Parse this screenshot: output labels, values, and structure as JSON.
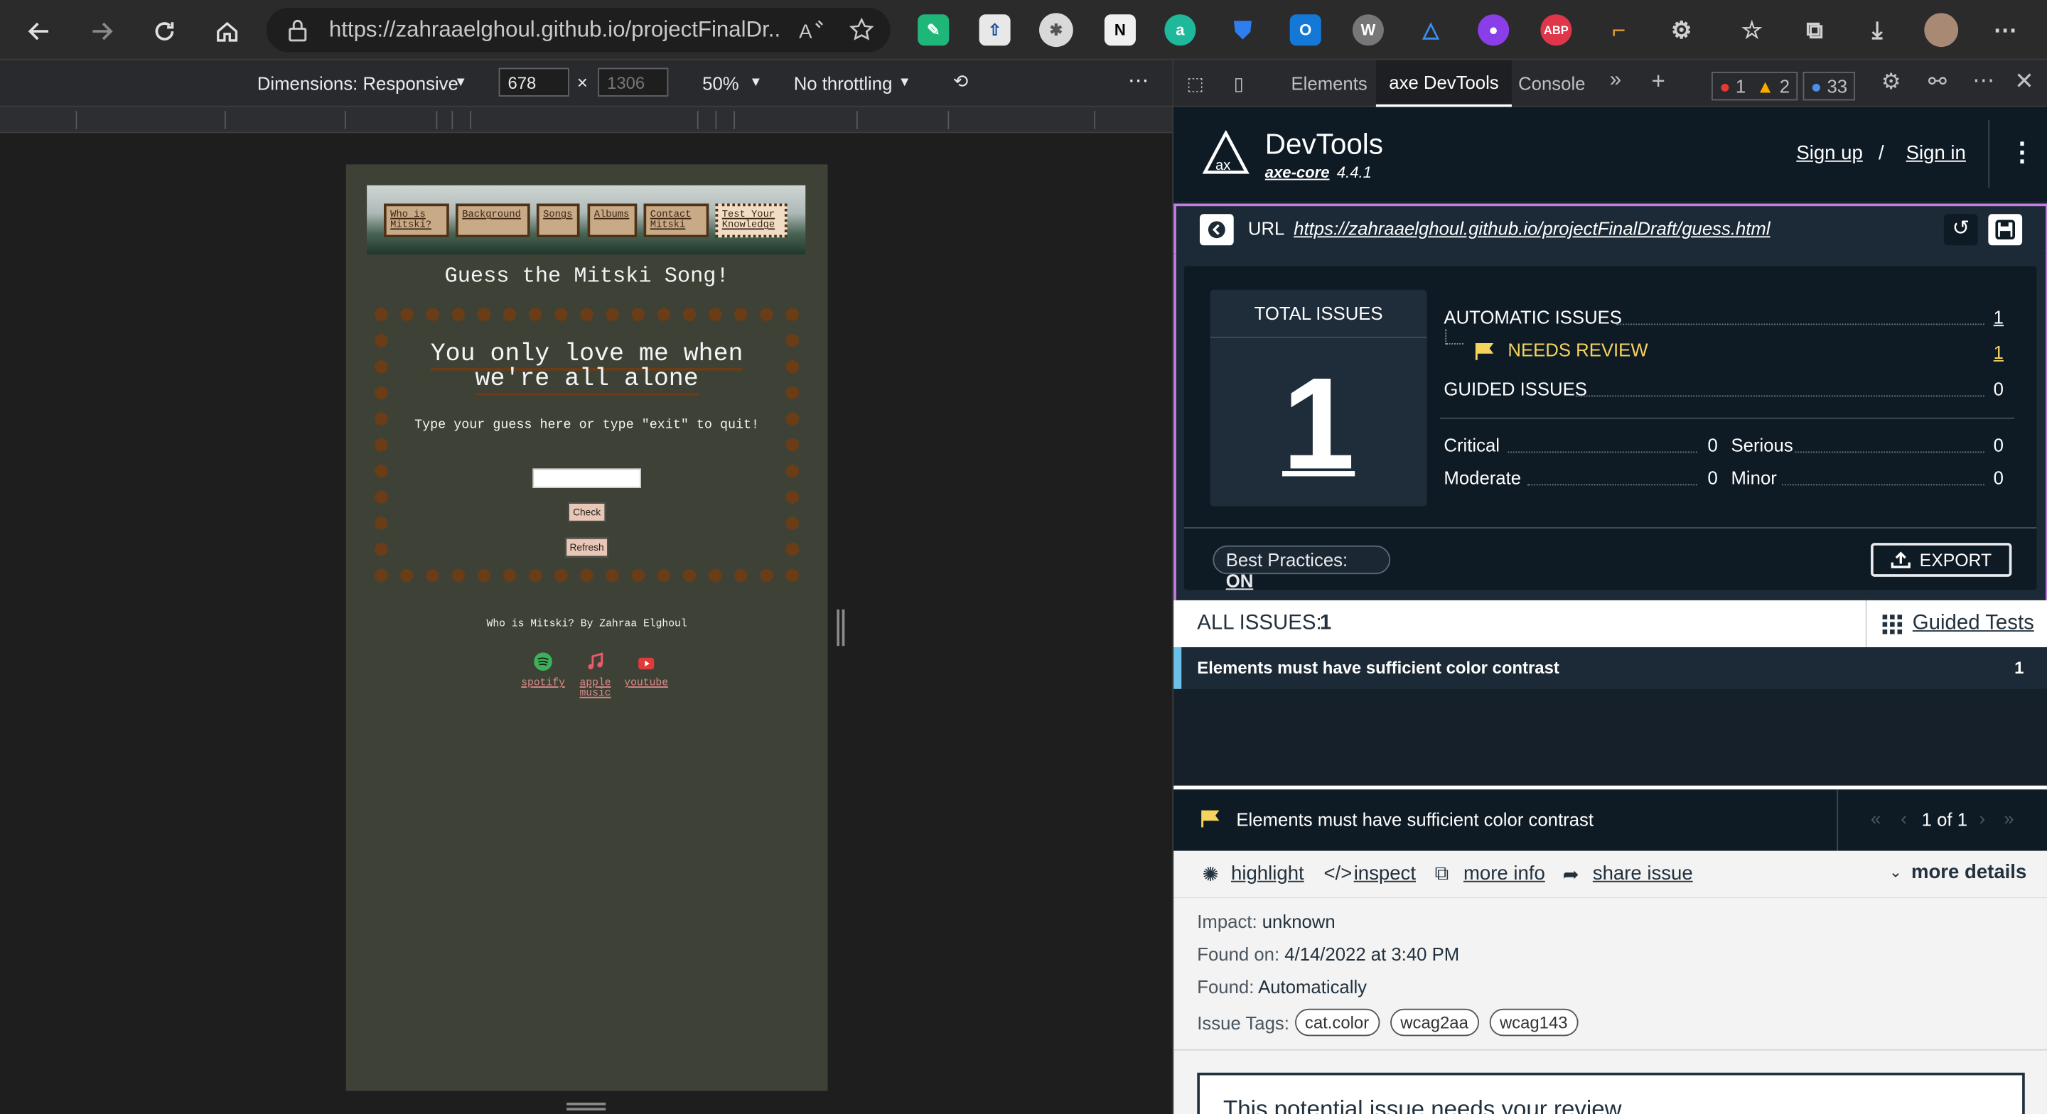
{
  "browser": {
    "url": "https://zahraaelghoul.github.io/projectFinalDr...",
    "extensions": [
      "a",
      "ABP"
    ]
  },
  "device_toolbar": {
    "dimensions_label": "Dimensions: Responsive",
    "width": "678",
    "height": "1306",
    "zoom": "50%",
    "throttle": "No throttling"
  },
  "page": {
    "nav": [
      "Who is Mitski?",
      "Background",
      "Songs",
      "Albums",
      "Contact Mitski",
      "Test Your Knowledge"
    ],
    "title": "Guess the Mitski Song!",
    "lyric": "You only love me when we're all alone",
    "instructions": "Type your guess here or type \"exit\" to quit!",
    "check_label": "Check",
    "refresh_label": "Refresh",
    "credit": "Who is Mitski? By Zahraa Elghoul",
    "social": [
      "spotify",
      "apple music",
      "youtube"
    ]
  },
  "devtools": {
    "tabs": [
      "Elements",
      "axe DevTools",
      "Console"
    ],
    "errors": "1",
    "warnings": "2",
    "info": "33"
  },
  "axe": {
    "brand": "DevTools",
    "engine": "axe-core",
    "version": "4.4.1",
    "sign_up": "Sign up",
    "separator": "/",
    "sign_in": "Sign in",
    "url_label": "URL",
    "url": "https://zahraaelghoul.github.io/projectFinalDraft/guess.html",
    "total_label": "TOTAL ISSUES",
    "total_value": "1",
    "automatic_label": "AUTOMATIC ISSUES",
    "automatic_value": "1",
    "needs_review_label": "NEEDS REVIEW",
    "needs_review_value": "1",
    "guided_label": "GUIDED ISSUES",
    "guided_value": "0",
    "critical_label": "Critical",
    "critical_value": "0",
    "serious_label": "Serious",
    "serious_value": "0",
    "moderate_label": "Moderate",
    "moderate_value": "0",
    "minor_label": "Minor",
    "minor_value": "0",
    "best_practices_label": "Best Practices:",
    "best_practices_value": "ON",
    "export_label": "EXPORT",
    "all_issues_label": "ALL ISSUES:",
    "all_issues_value": "1",
    "guided_tests_label": "Guided Tests",
    "issue_title": "Elements must have sufficient color contrast",
    "issue_count": "1",
    "pager": "1 of 1",
    "actions": {
      "highlight": "highlight",
      "inspect": "inspect",
      "more_info": "more info",
      "share": "share issue",
      "more_details": "more details"
    },
    "impact_label": "Impact:",
    "impact_value": "unknown",
    "found_on_label": "Found on:",
    "found_on_value": "4/14/2022 at 3:40 PM",
    "found_label": "Found:",
    "found_value": "Automatically",
    "tags_label": "Issue Tags:",
    "tags": [
      "cat.color",
      "wcag2aa",
      "wcag143"
    ],
    "review_notice": "This potential issue needs your review"
  },
  "colors": {
    "axe_bg": "#0e1a24",
    "accent_purple": "#c27ee0",
    "needs_review": "#f5d35c",
    "page_bg": "#3e4136",
    "dot_border": "#6b3d16"
  }
}
